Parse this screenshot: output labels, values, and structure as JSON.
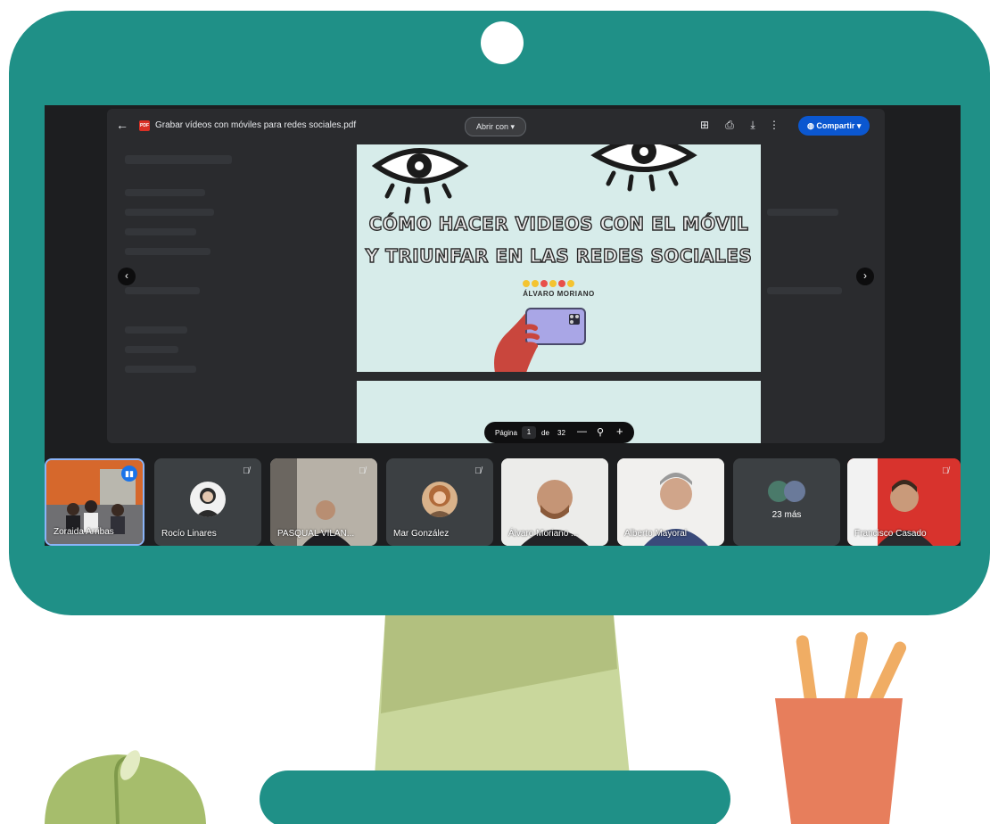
{
  "viewer": {
    "file_title": "Grabar vídeos con móviles para redes sociales.pdf",
    "file_badge": "PDF",
    "open_with_label": "Abrir con",
    "share_label": "Compartir"
  },
  "slide": {
    "title_line1": "CÓMO HACER VIDEOS CON EL MÓVIL",
    "title_line2": "Y TRIUNFAR EN LAS REDES SOCIALES",
    "author": "ÁLVARO MORIANO"
  },
  "page_control": {
    "page_label": "Página",
    "current_page": "1",
    "of_label": "de",
    "total_pages": "32"
  },
  "participants": [
    {
      "name": "Zoraida Arribas",
      "muted": false,
      "speaking": true
    },
    {
      "name": "Rocío Linares",
      "muted": true
    },
    {
      "name": "PASQUAL VILAN...",
      "muted": true
    },
    {
      "name": "Mar González",
      "muted": true
    },
    {
      "name": "Álvaro Moriano ...",
      "muted": false
    },
    {
      "name": "Alberto Mayoral",
      "muted": false
    },
    {
      "name": "Francisco Casado",
      "muted": true
    }
  ],
  "more_participants": "23 más",
  "colors": {
    "monitor": "#1f9087",
    "stand": "#c9d79c",
    "base": "#1f9087",
    "pot": "#e77e5c",
    "pencils": "#f0ad64",
    "plant": "#a6bd6c",
    "slide_bg": "#d7ecea",
    "share_button": "#0b57d0"
  }
}
